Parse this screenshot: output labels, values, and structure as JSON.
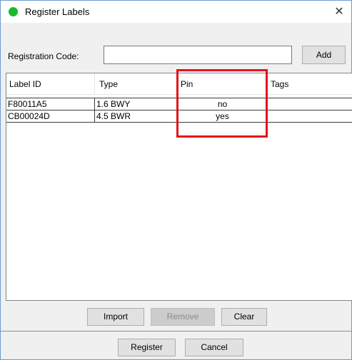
{
  "window": {
    "title": "Register Labels",
    "close_glyph": "✕"
  },
  "registration": {
    "label": "Registration Code:",
    "value": "",
    "add_label": "Add"
  },
  "table": {
    "columns": [
      "Label ID",
      "Type",
      "Pin",
      "Tags"
    ],
    "rows": [
      {
        "label_id": "F80011A5",
        "type": "1.6 BWY",
        "pin": "no",
        "tags": ""
      },
      {
        "label_id": "CB00024D",
        "type": "4.5 BWR",
        "pin": "yes",
        "tags": ""
      }
    ]
  },
  "actions": {
    "import": "Import",
    "remove": "Remove",
    "clear": "Clear"
  },
  "footer": {
    "register": "Register",
    "cancel": "Cancel"
  },
  "colors": {
    "status_dot": "#1bb82a",
    "highlight": "#e2121b"
  }
}
